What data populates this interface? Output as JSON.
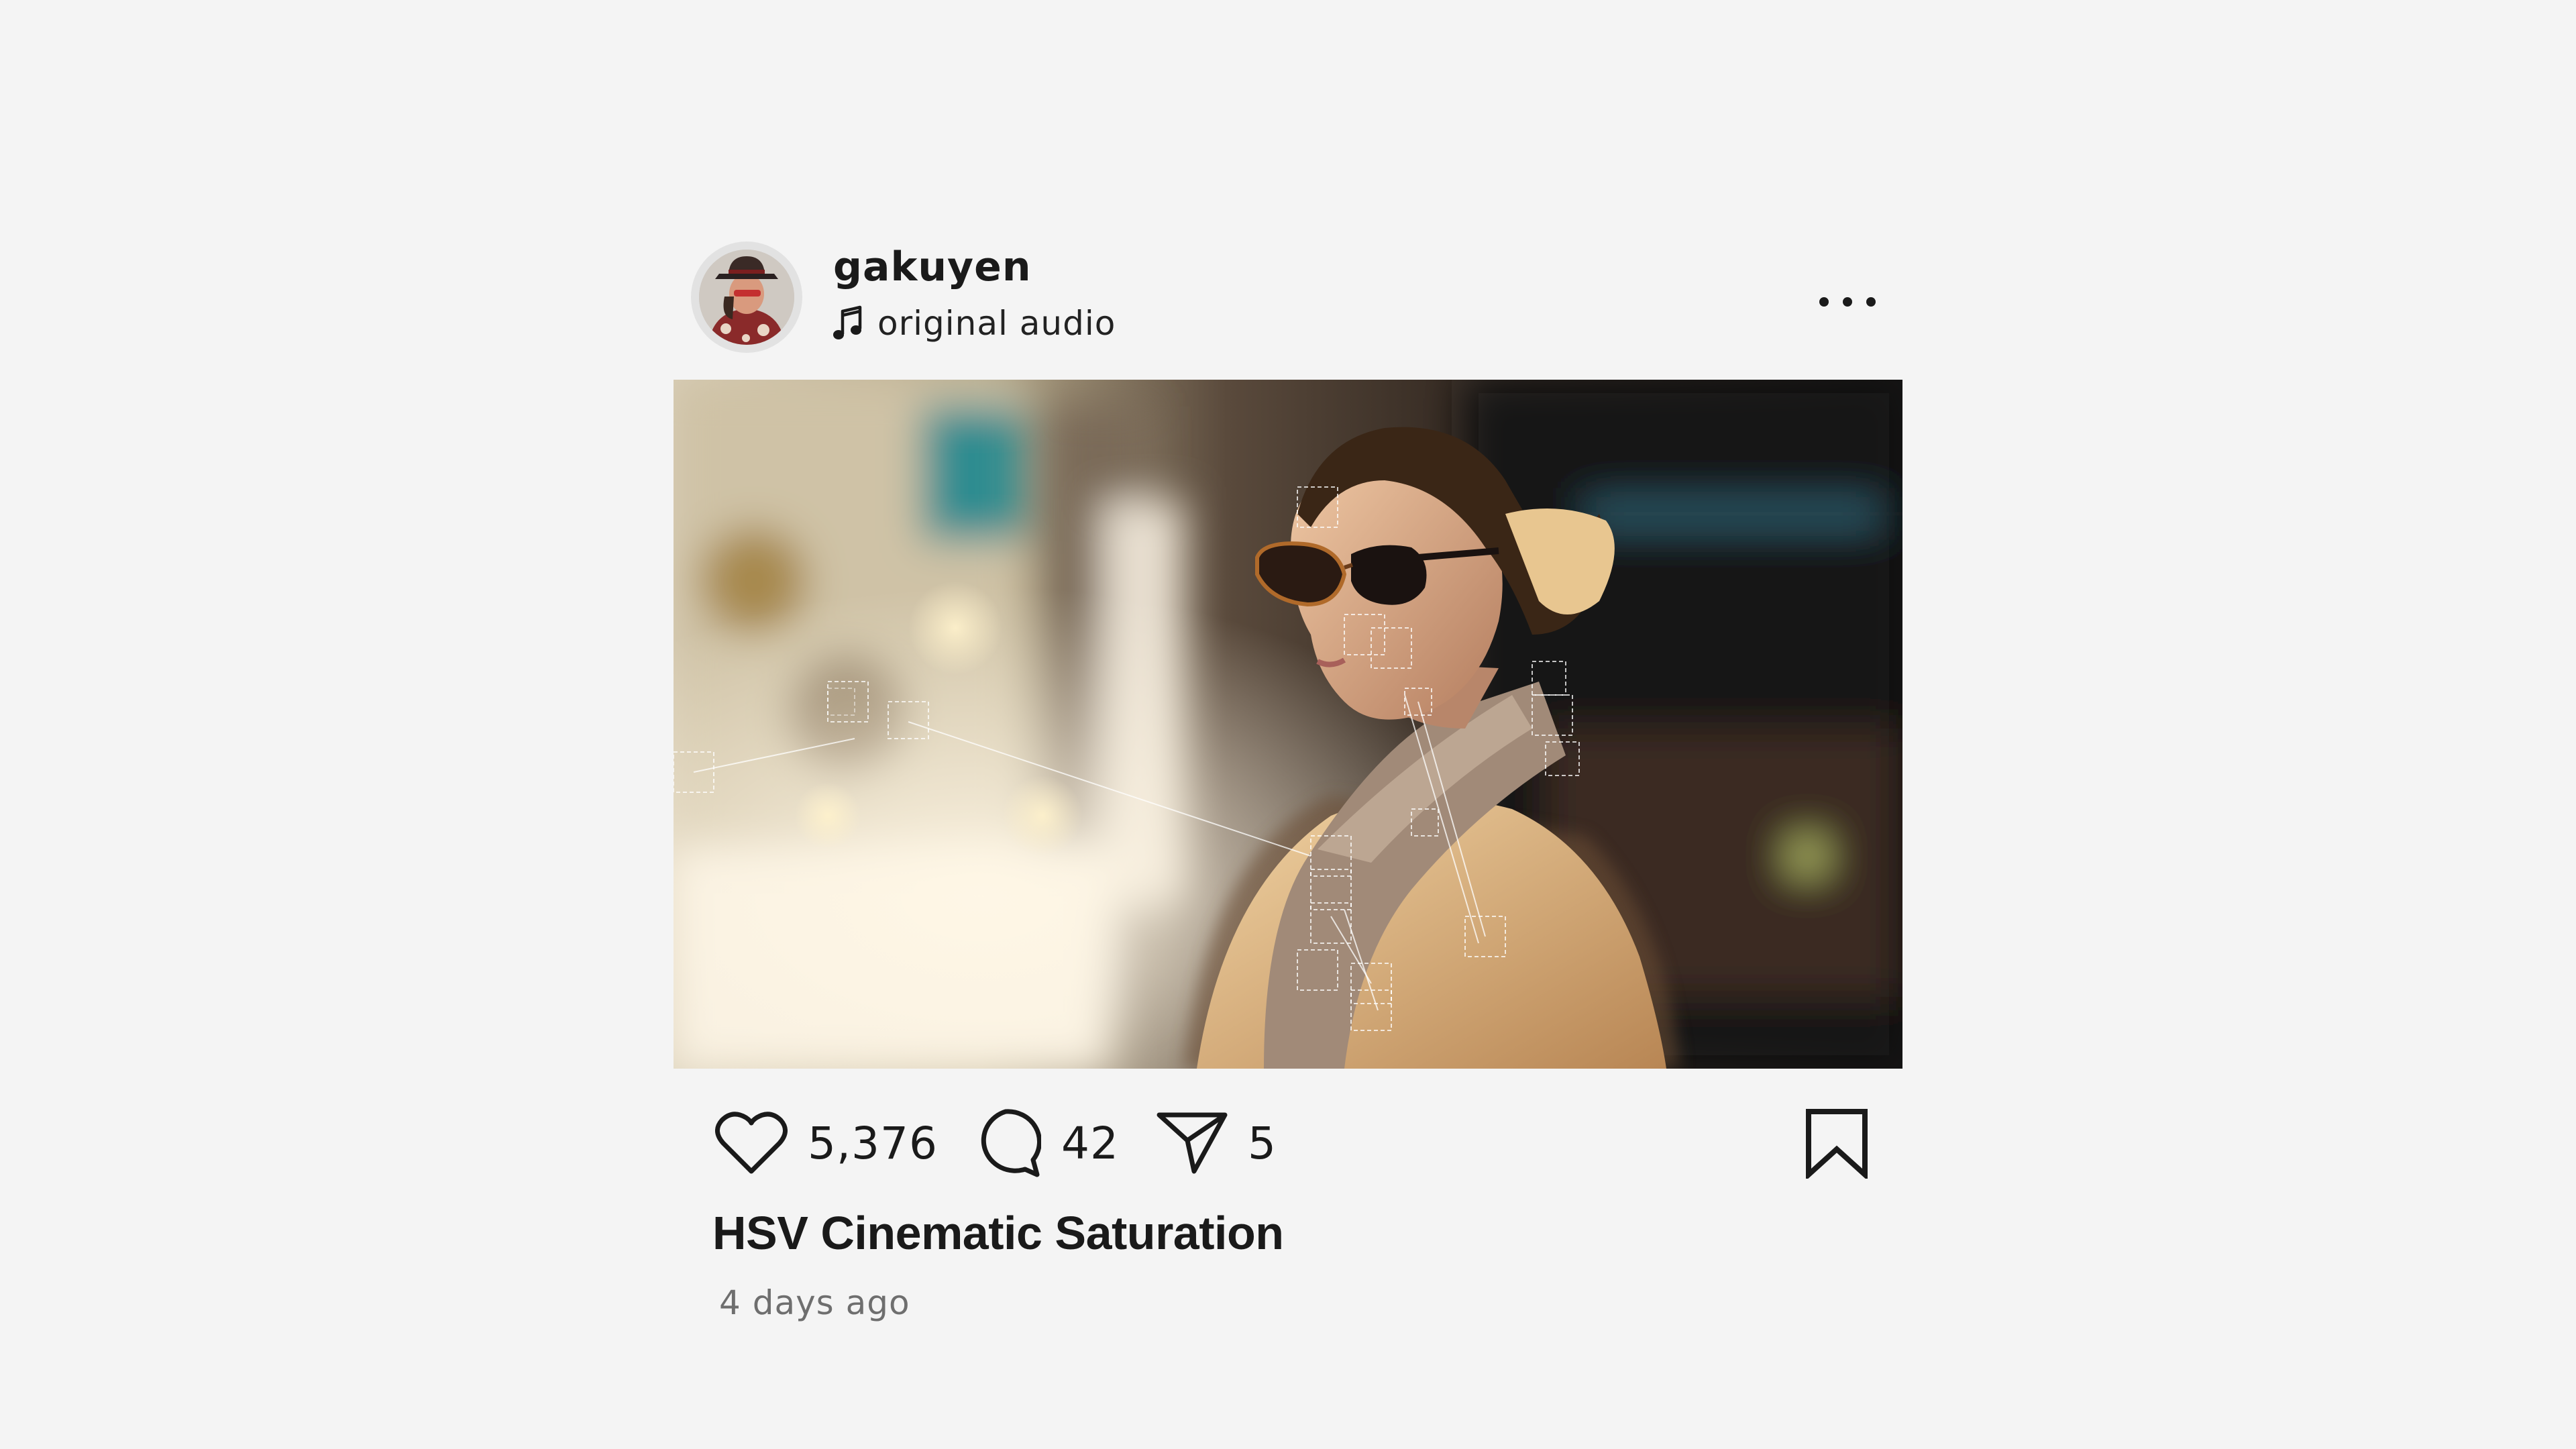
{
  "post": {
    "username": "gakuyen",
    "audio_label": "original audio",
    "music_icon": "music-note-icon",
    "more_icon": "more-horizontal-icon",
    "likes": "5,376",
    "comments": "42",
    "shares": "5",
    "caption": "HSV Cinematic Saturation",
    "timestamp": "4 days ago"
  },
  "icons": {
    "like": "heart-icon",
    "comment": "comment-bubble-icon",
    "share": "paper-plane-icon",
    "bookmark": "bookmark-icon"
  },
  "colors": {
    "background": "#f4f4f4",
    "text": "#1a1a1a",
    "secondary_text": "#6e6e6e"
  }
}
